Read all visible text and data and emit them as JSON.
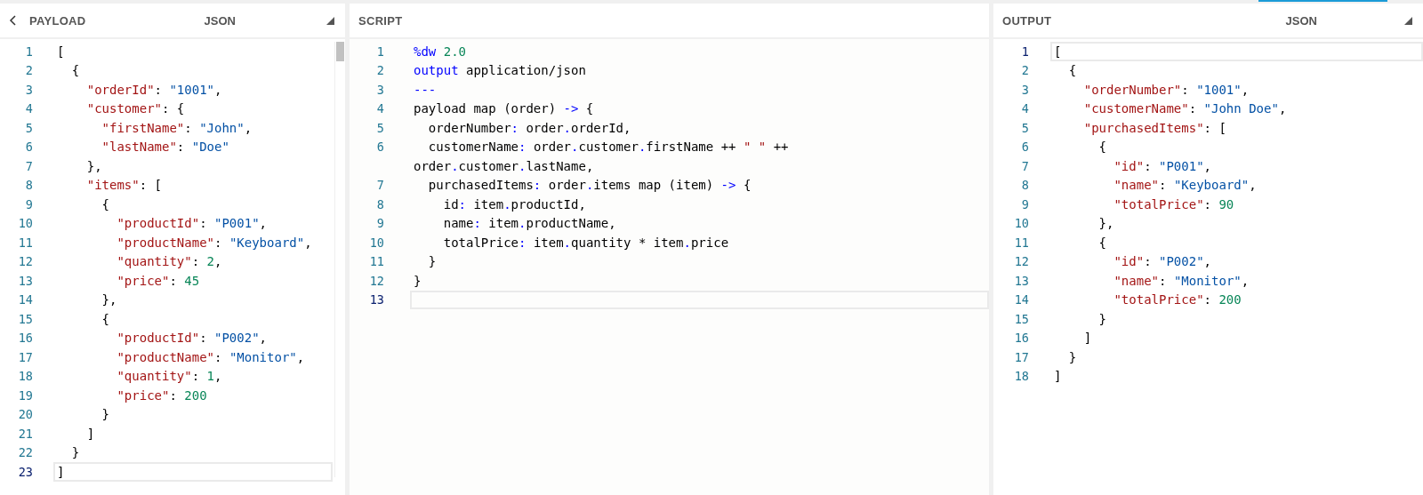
{
  "panels": [
    {
      "kind": "payload",
      "title": "PAYLOAD",
      "format": "JSON",
      "lines": [
        {
          "number": "1",
          "current": false,
          "tokens": [
            {
              "kind": "plain",
              "text": "["
            }
          ]
        },
        {
          "number": "2",
          "current": false,
          "tokens": [
            {
              "kind": "plain",
              "text": "  {"
            }
          ]
        },
        {
          "number": "3",
          "current": false,
          "tokens": [
            {
              "kind": "key",
              "text": "    \"orderId\""
            },
            {
              "kind": "plain",
              "text": ": "
            },
            {
              "kind": "str",
              "text": "\"1001\""
            },
            {
              "kind": "plain",
              "text": ","
            }
          ]
        },
        {
          "number": "4",
          "current": false,
          "tokens": [
            {
              "kind": "key",
              "text": "    \"customer\""
            },
            {
              "kind": "plain",
              "text": ": {"
            }
          ]
        },
        {
          "number": "5",
          "current": false,
          "tokens": [
            {
              "kind": "key",
              "text": "      \"firstName\""
            },
            {
              "kind": "plain",
              "text": ": "
            },
            {
              "kind": "str",
              "text": "\"John\""
            },
            {
              "kind": "plain",
              "text": ","
            }
          ]
        },
        {
          "number": "6",
          "current": false,
          "tokens": [
            {
              "kind": "key",
              "text": "      \"lastName\""
            },
            {
              "kind": "plain",
              "text": ": "
            },
            {
              "kind": "str",
              "text": "\"Doe\""
            }
          ]
        },
        {
          "number": "7",
          "current": false,
          "tokens": [
            {
              "kind": "plain",
              "text": "    },"
            }
          ]
        },
        {
          "number": "8",
          "current": false,
          "tokens": [
            {
              "kind": "key",
              "text": "    \"items\""
            },
            {
              "kind": "plain",
              "text": ": ["
            }
          ]
        },
        {
          "number": "9",
          "current": false,
          "tokens": [
            {
              "kind": "plain",
              "text": "      {"
            }
          ]
        },
        {
          "number": "10",
          "current": false,
          "tokens": [
            {
              "kind": "key",
              "text": "        \"productId\""
            },
            {
              "kind": "plain",
              "text": ": "
            },
            {
              "kind": "str",
              "text": "\"P001\""
            },
            {
              "kind": "plain",
              "text": ","
            }
          ]
        },
        {
          "number": "11",
          "current": false,
          "tokens": [
            {
              "kind": "key",
              "text": "        \"productName\""
            },
            {
              "kind": "plain",
              "text": ": "
            },
            {
              "kind": "str",
              "text": "\"Keyboard\""
            },
            {
              "kind": "plain",
              "text": ","
            }
          ]
        },
        {
          "number": "12",
          "current": false,
          "tokens": [
            {
              "kind": "key",
              "text": "        \"quantity\""
            },
            {
              "kind": "plain",
              "text": ": "
            },
            {
              "kind": "num",
              "text": "2"
            },
            {
              "kind": "plain",
              "text": ","
            }
          ]
        },
        {
          "number": "13",
          "current": false,
          "tokens": [
            {
              "kind": "key",
              "text": "        \"price\""
            },
            {
              "kind": "plain",
              "text": ": "
            },
            {
              "kind": "num",
              "text": "45"
            }
          ]
        },
        {
          "number": "14",
          "current": false,
          "tokens": [
            {
              "kind": "plain",
              "text": "      },"
            }
          ]
        },
        {
          "number": "15",
          "current": false,
          "tokens": [
            {
              "kind": "plain",
              "text": "      {"
            }
          ]
        },
        {
          "number": "16",
          "current": false,
          "tokens": [
            {
              "kind": "key",
              "text": "        \"productId\""
            },
            {
              "kind": "plain",
              "text": ": "
            },
            {
              "kind": "str",
              "text": "\"P002\""
            },
            {
              "kind": "plain",
              "text": ","
            }
          ]
        },
        {
          "number": "17",
          "current": false,
          "tokens": [
            {
              "kind": "key",
              "text": "        \"productName\""
            },
            {
              "kind": "plain",
              "text": ": "
            },
            {
              "kind": "str",
              "text": "\"Monitor\""
            },
            {
              "kind": "plain",
              "text": ","
            }
          ]
        },
        {
          "number": "18",
          "current": false,
          "tokens": [
            {
              "kind": "key",
              "text": "        \"quantity\""
            },
            {
              "kind": "plain",
              "text": ": "
            },
            {
              "kind": "num",
              "text": "1"
            },
            {
              "kind": "plain",
              "text": ","
            }
          ]
        },
        {
          "number": "19",
          "current": false,
          "tokens": [
            {
              "kind": "key",
              "text": "        \"price\""
            },
            {
              "kind": "plain",
              "text": ": "
            },
            {
              "kind": "num",
              "text": "200"
            }
          ]
        },
        {
          "number": "20",
          "current": false,
          "tokens": [
            {
              "kind": "plain",
              "text": "      }"
            }
          ]
        },
        {
          "number": "21",
          "current": false,
          "tokens": [
            {
              "kind": "plain",
              "text": "    ]"
            }
          ]
        },
        {
          "number": "22",
          "current": false,
          "tokens": [
            {
              "kind": "plain",
              "text": "  }"
            }
          ]
        },
        {
          "number": "23",
          "current": true,
          "tokens": [
            {
              "kind": "plain",
              "text": "]"
            }
          ]
        }
      ]
    },
    {
      "kind": "script",
      "title": "SCRIPT",
      "lines": [
        {
          "number": "1",
          "current": false,
          "tokens": [
            {
              "kind": "kw",
              "text": "%dw"
            },
            {
              "kind": "num",
              "text": " 2.0"
            }
          ]
        },
        {
          "number": "2",
          "current": false,
          "tokens": [
            {
              "kind": "kw",
              "text": "output"
            },
            {
              "kind": "plain",
              "text": " application/json"
            }
          ]
        },
        {
          "number": "3",
          "current": false,
          "tokens": [
            {
              "kind": "kw",
              "text": "---"
            }
          ]
        },
        {
          "number": "4",
          "current": false,
          "tokens": [
            {
              "kind": "plain",
              "text": "payload map (order) "
            },
            {
              "kind": "kw",
              "text": "->"
            },
            {
              "kind": "plain",
              "text": " {"
            }
          ]
        },
        {
          "number": "5",
          "current": false,
          "tokens": [
            {
              "kind": "plain",
              "text": "  orderNumber"
            },
            {
              "kind": "kw",
              "text": ":"
            },
            {
              "kind": "plain",
              "text": " order"
            },
            {
              "kind": "kw",
              "text": "."
            },
            {
              "kind": "plain",
              "text": "orderId,"
            }
          ]
        },
        {
          "number": "6",
          "current": false,
          "tokens": [
            {
              "kind": "plain",
              "text": "  customerName"
            },
            {
              "kind": "kw",
              "text": ":"
            },
            {
              "kind": "plain",
              "text": " order"
            },
            {
              "kind": "kw",
              "text": "."
            },
            {
              "kind": "plain",
              "text": "customer"
            },
            {
              "kind": "kw",
              "text": "."
            },
            {
              "kind": "plain",
              "text": "firstName ++ "
            },
            {
              "kind": "key",
              "text": "\" \""
            },
            {
              "kind": "plain",
              "text": " ++"
            }
          ]
        },
        {
          "current": false,
          "tokens": [
            {
              "kind": "plain",
              "text": "order"
            },
            {
              "kind": "kw",
              "text": "."
            },
            {
              "kind": "plain",
              "text": "customer"
            },
            {
              "kind": "kw",
              "text": "."
            },
            {
              "kind": "plain",
              "text": "lastName,"
            }
          ]
        },
        {
          "number": "7",
          "current": false,
          "tokens": [
            {
              "kind": "plain",
              "text": "  purchasedItems"
            },
            {
              "kind": "kw",
              "text": ":"
            },
            {
              "kind": "plain",
              "text": " order"
            },
            {
              "kind": "kw",
              "text": "."
            },
            {
              "kind": "plain",
              "text": "items map (item) "
            },
            {
              "kind": "kw",
              "text": "->"
            },
            {
              "kind": "plain",
              "text": " {"
            }
          ]
        },
        {
          "number": "8",
          "current": false,
          "tokens": [
            {
              "kind": "plain",
              "text": "    id"
            },
            {
              "kind": "kw",
              "text": ":"
            },
            {
              "kind": "plain",
              "text": " item"
            },
            {
              "kind": "kw",
              "text": "."
            },
            {
              "kind": "plain",
              "text": "productId,"
            }
          ]
        },
        {
          "number": "9",
          "current": false,
          "tokens": [
            {
              "kind": "plain",
              "text": "    name"
            },
            {
              "kind": "kw",
              "text": ":"
            },
            {
              "kind": "plain",
              "text": " item"
            },
            {
              "kind": "kw",
              "text": "."
            },
            {
              "kind": "plain",
              "text": "productName,"
            }
          ]
        },
        {
          "number": "10",
          "current": false,
          "tokens": [
            {
              "kind": "plain",
              "text": "    totalPrice"
            },
            {
              "kind": "kw",
              "text": ":"
            },
            {
              "kind": "plain",
              "text": " item"
            },
            {
              "kind": "kw",
              "text": "."
            },
            {
              "kind": "plain",
              "text": "quantity * item"
            },
            {
              "kind": "kw",
              "text": "."
            },
            {
              "kind": "plain",
              "text": "price"
            }
          ]
        },
        {
          "number": "11",
          "current": false,
          "tokens": [
            {
              "kind": "plain",
              "text": "  }"
            }
          ]
        },
        {
          "number": "12",
          "current": false,
          "tokens": [
            {
              "kind": "plain",
              "text": "}"
            }
          ]
        },
        {
          "number": "13",
          "current": true
        }
      ]
    },
    {
      "kind": "output",
      "title": "OUTPUT",
      "format": "JSON",
      "lines": [
        {
          "number": "1",
          "current": true,
          "tokens": [
            {
              "kind": "plain",
              "text": "["
            }
          ]
        },
        {
          "number": "2",
          "current": false,
          "tokens": [
            {
              "kind": "plain",
              "text": "  {"
            }
          ]
        },
        {
          "number": "3",
          "current": false,
          "tokens": [
            {
              "kind": "key",
              "text": "    \"orderNumber\""
            },
            {
              "kind": "plain",
              "text": ": "
            },
            {
              "kind": "str",
              "text": "\"1001\""
            },
            {
              "kind": "plain",
              "text": ","
            }
          ]
        },
        {
          "number": "4",
          "current": false,
          "tokens": [
            {
              "kind": "key",
              "text": "    \"customerName\""
            },
            {
              "kind": "plain",
              "text": ": "
            },
            {
              "kind": "str",
              "text": "\"John Doe\""
            },
            {
              "kind": "plain",
              "text": ","
            }
          ]
        },
        {
          "number": "5",
          "current": false,
          "tokens": [
            {
              "kind": "key",
              "text": "    \"purchasedItems\""
            },
            {
              "kind": "plain",
              "text": ": ["
            }
          ]
        },
        {
          "number": "6",
          "current": false,
          "tokens": [
            {
              "kind": "plain",
              "text": "      {"
            }
          ]
        },
        {
          "number": "7",
          "current": false,
          "tokens": [
            {
              "kind": "key",
              "text": "        \"id\""
            },
            {
              "kind": "plain",
              "text": ": "
            },
            {
              "kind": "str",
              "text": "\"P001\""
            },
            {
              "kind": "plain",
              "text": ","
            }
          ]
        },
        {
          "number": "8",
          "current": false,
          "tokens": [
            {
              "kind": "key",
              "text": "        \"name\""
            },
            {
              "kind": "plain",
              "text": ": "
            },
            {
              "kind": "str",
              "text": "\"Keyboard\""
            },
            {
              "kind": "plain",
              "text": ","
            }
          ]
        },
        {
          "number": "9",
          "current": false,
          "tokens": [
            {
              "kind": "key",
              "text": "        \"totalPrice\""
            },
            {
              "kind": "plain",
              "text": ": "
            },
            {
              "kind": "num",
              "text": "90"
            }
          ]
        },
        {
          "number": "10",
          "current": false,
          "tokens": [
            {
              "kind": "plain",
              "text": "      },"
            }
          ]
        },
        {
          "number": "11",
          "current": false,
          "tokens": [
            {
              "kind": "plain",
              "text": "      {"
            }
          ]
        },
        {
          "number": "12",
          "current": false,
          "tokens": [
            {
              "kind": "key",
              "text": "        \"id\""
            },
            {
              "kind": "plain",
              "text": ": "
            },
            {
              "kind": "str",
              "text": "\"P002\""
            },
            {
              "kind": "plain",
              "text": ","
            }
          ]
        },
        {
          "number": "13",
          "current": false,
          "tokens": [
            {
              "kind": "key",
              "text": "        \"name\""
            },
            {
              "kind": "plain",
              "text": ": "
            },
            {
              "kind": "str",
              "text": "\"Monitor\""
            },
            {
              "kind": "plain",
              "text": ","
            }
          ]
        },
        {
          "number": "14",
          "current": false,
          "tokens": [
            {
              "kind": "key",
              "text": "        \"totalPrice\""
            },
            {
              "kind": "plain",
              "text": ": "
            },
            {
              "kind": "num",
              "text": "200"
            }
          ]
        },
        {
          "number": "15",
          "current": false,
          "tokens": [
            {
              "kind": "plain",
              "text": "      }"
            }
          ]
        },
        {
          "number": "16",
          "current": false,
          "tokens": [
            {
              "kind": "plain",
              "text": "    ]"
            }
          ]
        },
        {
          "number": "17",
          "current": false,
          "tokens": [
            {
              "kind": "plain",
              "text": "  }"
            }
          ]
        },
        {
          "number": "18",
          "current": false,
          "tokens": [
            {
              "kind": "plain",
              "text": "]"
            }
          ]
        }
      ]
    }
  ]
}
